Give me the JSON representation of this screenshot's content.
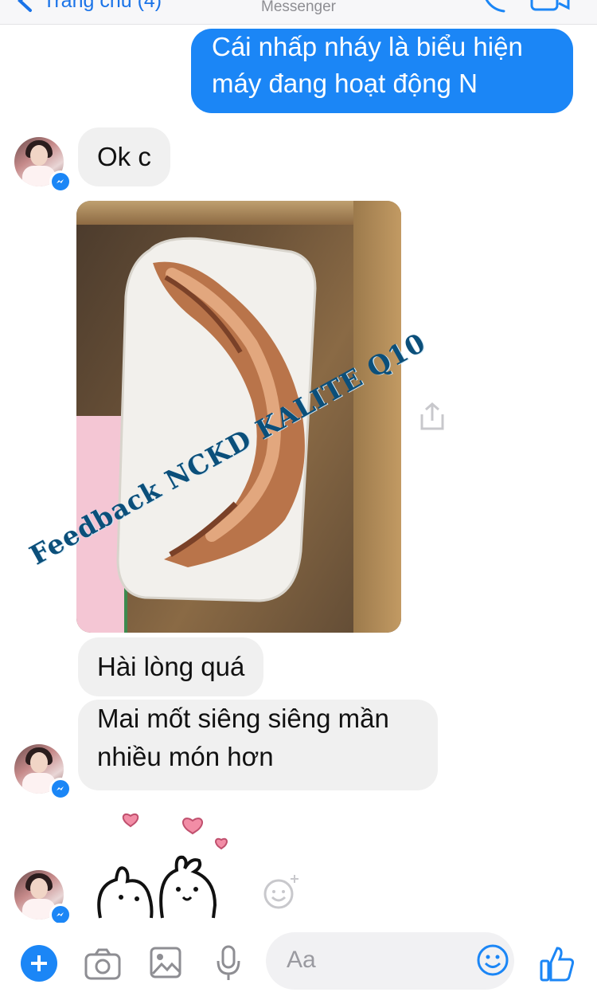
{
  "header": {
    "back_label": "Trang chủ (4)",
    "title": "Messenger"
  },
  "messages": {
    "outgoing_1": "Cái nhấp nháy là biểu hiện máy đang hoạt động N",
    "incoming_1": "Ok c",
    "incoming_2": "Hài lòng quá",
    "incoming_3": "Mai mốt siêng siêng mần nhiều món hơn"
  },
  "watermark": "Feedback NCKD KALITE Q10",
  "composer": {
    "placeholder": "Aa"
  },
  "colors": {
    "accent": "#1b86f6",
    "incoming_bubble": "#f0f0f0",
    "watermark": "#0b4f7a"
  },
  "icons": [
    "back-chevron-icon",
    "phone-icon",
    "video-icon",
    "messenger-badge-icon",
    "share-icon",
    "add-reaction-icon",
    "plus-icon",
    "camera-icon",
    "gallery-icon",
    "mic-icon",
    "emoji-icon",
    "like-icon"
  ]
}
